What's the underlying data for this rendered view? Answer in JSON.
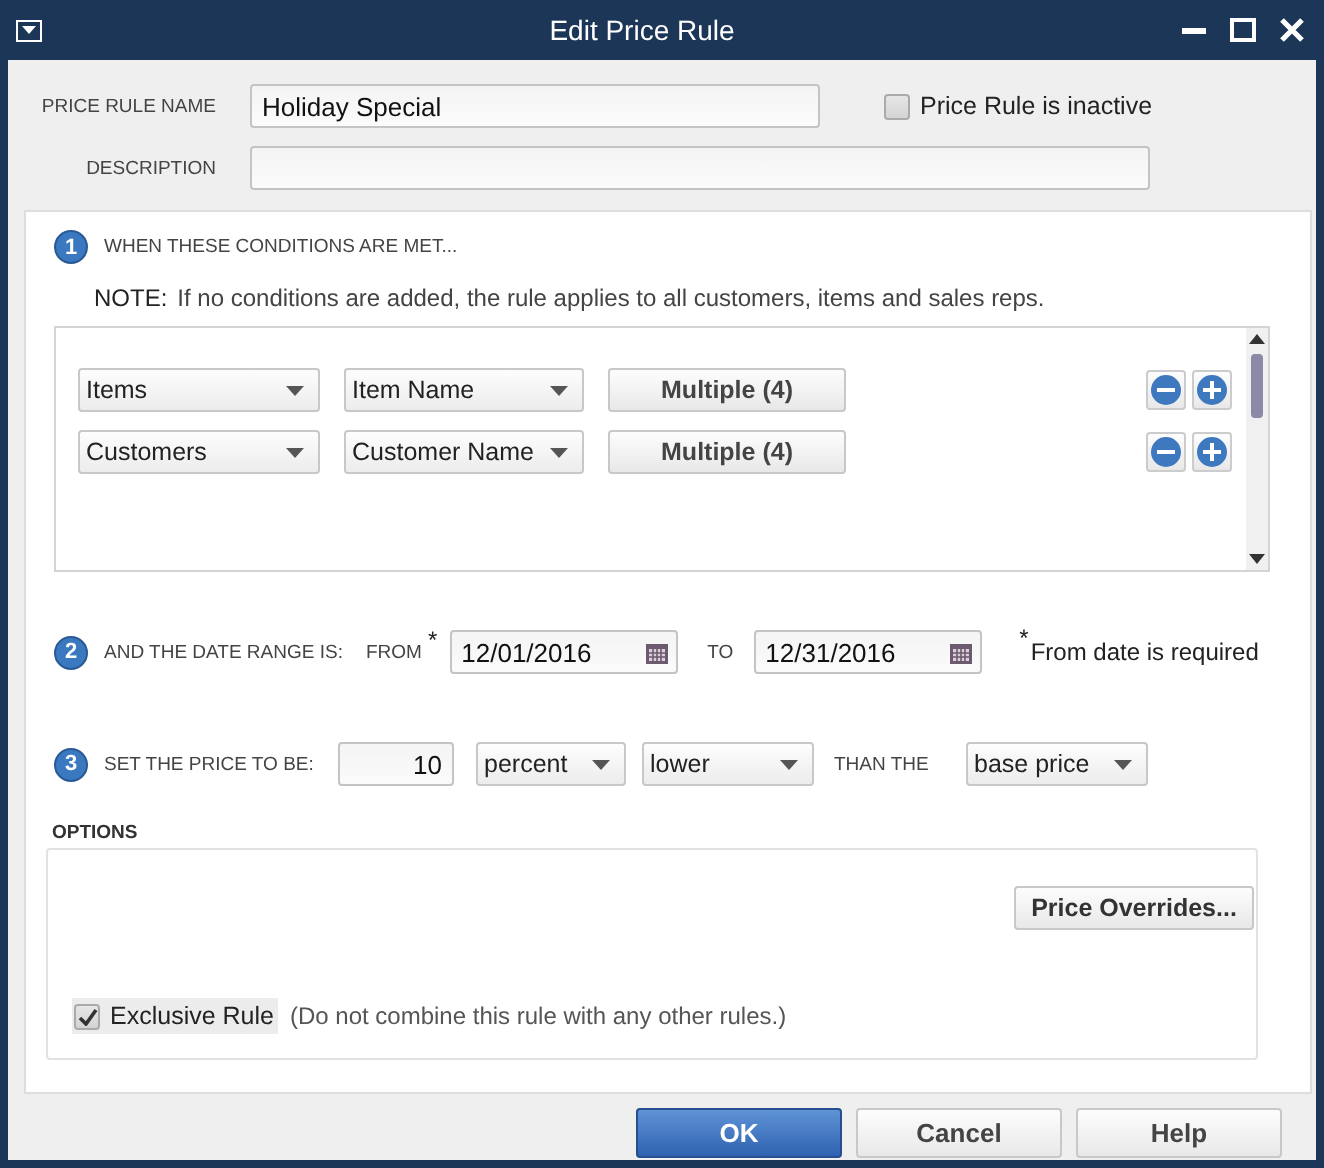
{
  "window": {
    "title": "Edit Price Rule"
  },
  "price_rule_name": {
    "label": "PRICE RULE NAME",
    "value": "Holiday Special"
  },
  "inactive": {
    "label": "Price Rule is inactive",
    "checked": false
  },
  "description": {
    "label": "DESCRIPTION"
  },
  "conditions": {
    "number": "1",
    "heading": "WHEN THESE CONDITIONS ARE MET...",
    "note_label": "NOTE:",
    "note": "If no conditions are added, the rule applies to all customers, items and sales reps.",
    "rows": [
      {
        "type": "Items",
        "field": "Item Name",
        "value": "Multiple (4)"
      },
      {
        "type": "Customers",
        "field": "Customer Name",
        "value": "Multiple (4)"
      }
    ]
  },
  "date_range": {
    "number": "2",
    "label": "AND THE DATE RANGE IS:",
    "from_label": "FROM",
    "from_mark": "*",
    "from": "12/01/2016",
    "to_label": "TO",
    "to": "12/31/2016",
    "required_mark": "*",
    "required_note": "From date is required"
  },
  "price": {
    "number": "3",
    "label": "SET THE PRICE TO BE:",
    "amount": "10",
    "unit": "percent",
    "direction": "lower",
    "than_label": "THAN THE",
    "base": "base price"
  },
  "options": {
    "heading": "OPTIONS",
    "overrides_button": "Price Overrides...",
    "exclusive": {
      "label": "Exclusive Rule",
      "checked": true
    },
    "exclusive_note": "(Do not combine this rule with any other rules.)"
  },
  "buttons": [
    {
      "label": "OK",
      "default": true
    },
    {
      "label": "Cancel",
      "default": false
    },
    {
      "label": "Help",
      "default": false
    }
  ]
}
